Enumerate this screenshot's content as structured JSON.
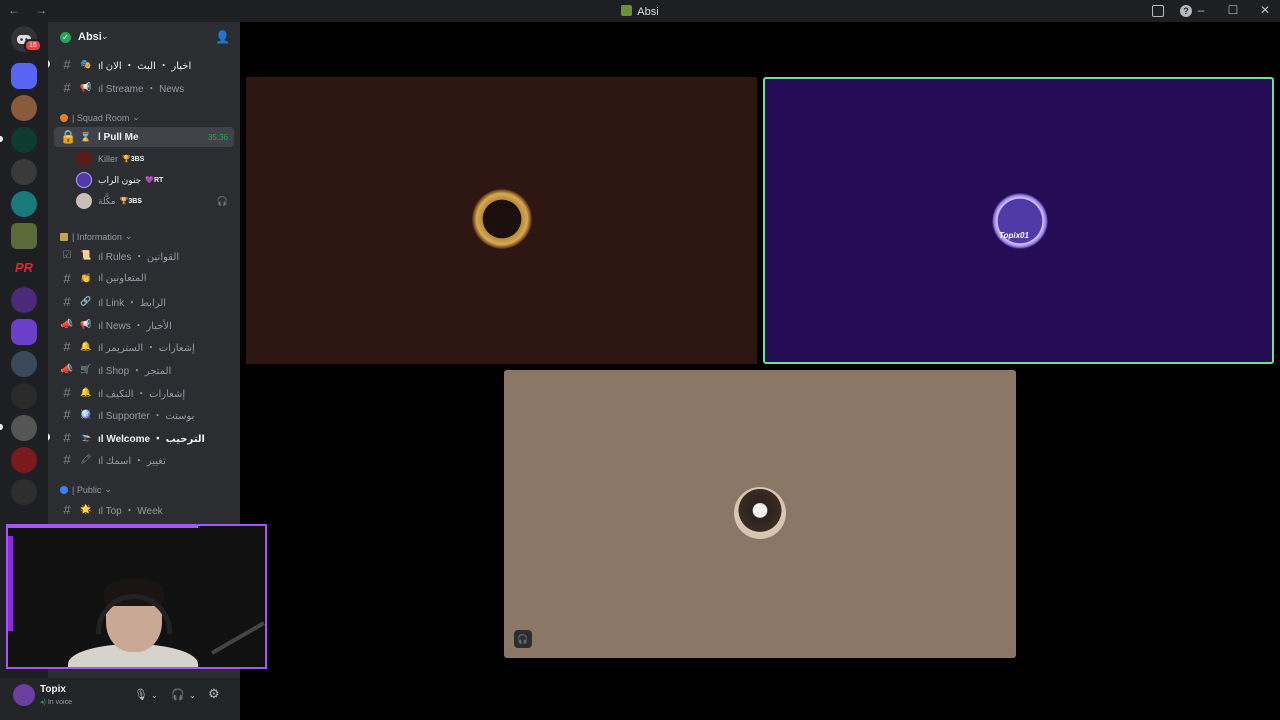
{
  "window": {
    "title": "Absi",
    "nav": "← →",
    "controls": [
      "–",
      "☐",
      "✕"
    ]
  },
  "rail": {
    "home_badge": "16"
  },
  "guild": {
    "name": "Absi",
    "invite_icon": "add-member-icon"
  },
  "channels_top": [
    {
      "emoji": "🎭",
      "label": "ıl اخبار ・ البث ・ الان"
    },
    {
      "emoji": "📢",
      "label": "ıl Streame ・ News"
    }
  ],
  "squad": {
    "category": "| Squad Room",
    "voice": {
      "label": "l Pull Me",
      "time": "35:36"
    },
    "members": [
      {
        "name": "Killer",
        "tag": "3BS",
        "tag_emoji": "🏆"
      },
      {
        "name": "جنون الراب",
        "tag": "RT",
        "tag_emoji": "💜"
      },
      {
        "name": "مكَّلة",
        "tag": "3BS",
        "tag_emoji": "🏆"
      }
    ]
  },
  "information": {
    "category": "| Information",
    "channels": [
      {
        "emoji": "📜",
        "label": "ıl Rules ・ القوانين",
        "bright": false,
        "hash": "☑"
      },
      {
        "emoji": "👏",
        "label": "ıl المتعاونين",
        "bright": false,
        "hash": "#"
      },
      {
        "emoji": "🔗",
        "label": "ıl Link ・ الرابط",
        "bright": false,
        "hash": "#"
      },
      {
        "emoji": "📢",
        "label": "ıl News ・ الأخبار",
        "bright": false,
        "hash": "📣"
      },
      {
        "emoji": "🔔",
        "label": "ıl إشعارات ・ الستريمر",
        "bright": false,
        "hash": "#"
      },
      {
        "emoji": "🛒",
        "label": "ıl Shop ・ المتجر",
        "bright": false,
        "hash": "📣"
      },
      {
        "emoji": "🔔",
        "label": "ıl إشعارات ・ التكيف",
        "bright": false,
        "hash": "#"
      },
      {
        "emoji": "🪩",
        "label": "ıl Supporter ・ بوستت",
        "bright": false,
        "hash": "#"
      },
      {
        "emoji": "🛬",
        "label": "ıl Welcome ・ الترحيب",
        "bright": true,
        "hash": "#"
      },
      {
        "emoji": "🖍",
        "label": "ıl تغيير ・ اسمك",
        "bright": false,
        "hash": "#"
      }
    ]
  },
  "public": {
    "category": "| Public",
    "channels": [
      {
        "emoji": "🌟",
        "label": "ıl Top ・ Week"
      }
    ]
  },
  "user": {
    "name": "Topix",
    "status": "In voice"
  },
  "stage": {
    "tile2_label": "Topix01"
  },
  "colors": {
    "accent": "#a855f7",
    "speaking": "#6de38b",
    "online": "#23a55a",
    "danger": "#f23f43"
  }
}
